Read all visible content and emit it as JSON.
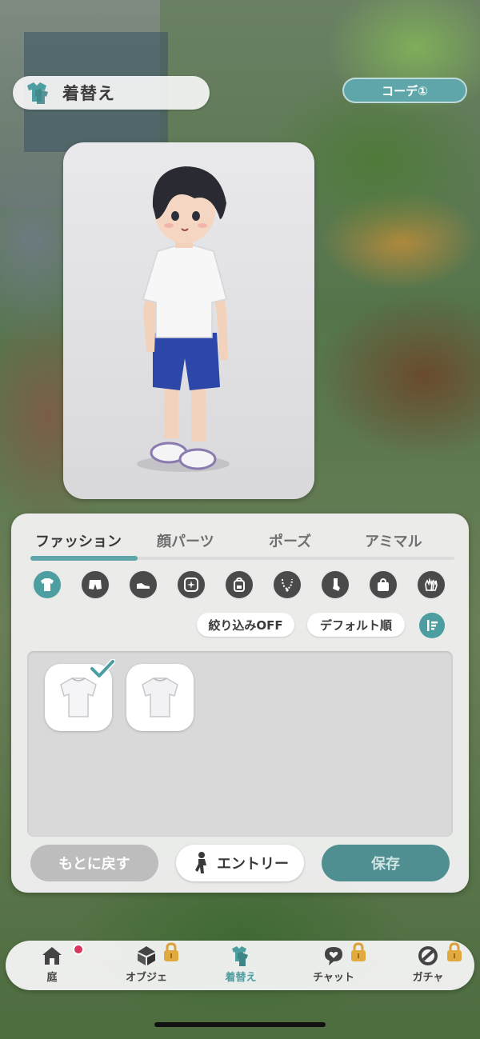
{
  "header": {
    "title": "着替え",
    "icon": "clothes-hanger-icon"
  },
  "coordinate_button": {
    "label": "コーデ①"
  },
  "tabs": [
    {
      "label": "ファッション",
      "active": true
    },
    {
      "label": "顔パーツ",
      "active": false
    },
    {
      "label": "ポーズ",
      "active": false
    },
    {
      "label": "アミマル",
      "active": false
    }
  ],
  "categories": [
    {
      "icon": "tshirt-icon",
      "active": true
    },
    {
      "icon": "shorts-icon",
      "active": false
    },
    {
      "icon": "shoe-icon",
      "active": false
    },
    {
      "icon": "sparkle-icon",
      "active": false
    },
    {
      "icon": "backpack-icon",
      "active": false
    },
    {
      "icon": "necklace-icon",
      "active": false
    },
    {
      "icon": "sock-icon",
      "active": false
    },
    {
      "icon": "bag-icon",
      "active": false
    },
    {
      "icon": "gloves-icon",
      "active": false
    }
  ],
  "filters": {
    "filter_label": "絞り込みOFF",
    "sort_label": "デフォルト順",
    "sort_icon": "sort-icon"
  },
  "items": [
    {
      "name": "white-tshirt",
      "selected": true
    },
    {
      "name": "white-tshirt",
      "selected": false
    }
  ],
  "actions": {
    "revert_label": "もとに戻す",
    "entry_label": "エントリー",
    "save_label": "保存"
  },
  "bottom_nav": [
    {
      "label": "庭",
      "icon": "home-icon",
      "badge": true,
      "locked": false,
      "active": false
    },
    {
      "label": "オブジェ",
      "icon": "object-icon",
      "badge": false,
      "locked": true,
      "active": false
    },
    {
      "label": "着替え",
      "icon": "clothes-icon",
      "badge": false,
      "locked": false,
      "active": true
    },
    {
      "label": "チャット",
      "icon": "chat-heart-icon",
      "badge": false,
      "locked": true,
      "active": false
    },
    {
      "label": "ガチャ",
      "icon": "gacha-icon",
      "badge": false,
      "locked": true,
      "active": false
    }
  ],
  "colors": {
    "accent": "#5ea6a9",
    "accent_dark": "#4d9ea1",
    "badge": "#d8365b",
    "lock": "#d9a23a"
  }
}
